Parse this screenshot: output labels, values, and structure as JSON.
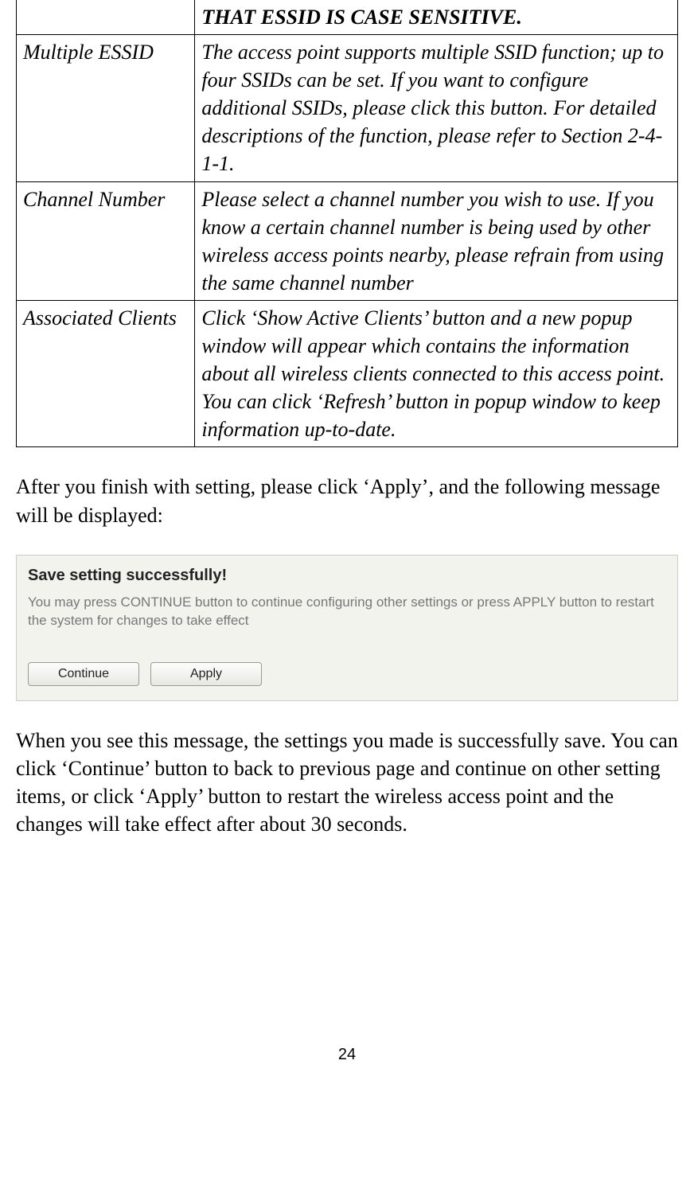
{
  "table": {
    "noteRow": {
      "term": "",
      "desc": "THAT ESSID IS CASE SENSITIVE."
    },
    "rows": [
      {
        "term": "Multiple ESSID",
        "desc": "The access point supports multiple SSID function; up to four SSIDs can be set. If you want to configure additional SSIDs, please click this button. For detailed descriptions of the function, please refer to Section 2-4-1-1."
      },
      {
        "term": "Channel  Number",
        "desc": "Please select a channel number you wish to use. If you know a certain channel number is being used by other wireless access points nearby, please refrain from using the same channel number"
      },
      {
        "term": "Associated Clients",
        "desc": "Click ‘Show Active Clients’ button and a new popup window will appear which contains the information about all wireless clients connected to this access point. You can click ‘Refresh’ button in popup window to keep information up-to-date."
      }
    ]
  },
  "paragraph1": "After you finish with setting, please click ‘Apply’, and the following message will be displayed:",
  "dialog": {
    "title": "Save setting successfully!",
    "message": "You may press CONTINUE button to continue configuring other settings or press APPLY button to restart the system for changes to take effect",
    "continue_label": "Continue",
    "apply_label": "Apply"
  },
  "paragraph2": "When you see this message, the settings you made is successfully save. You can click ‘Continue’ button to back to previous page and continue on other setting items, or click ‘Apply’ button to restart the wireless access point and the changes will take effect after about 30 seconds.",
  "page_number": "24"
}
